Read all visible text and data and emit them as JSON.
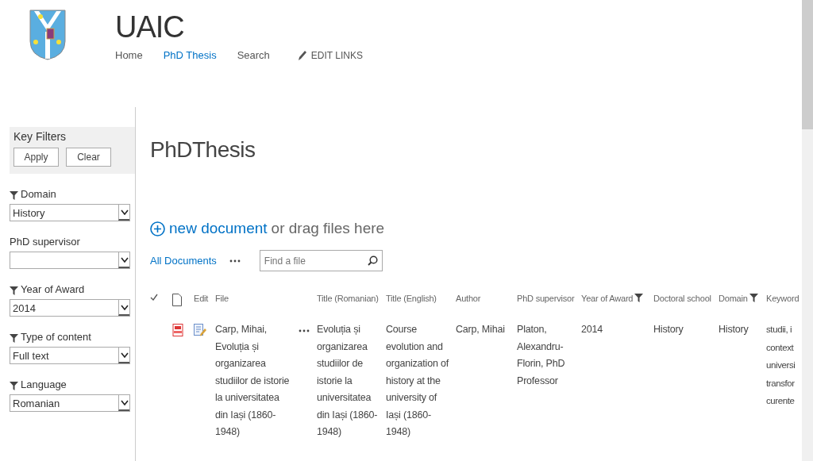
{
  "site": {
    "title": "UAIC",
    "nav": [
      {
        "label": "Home",
        "selected": false
      },
      {
        "label": "PhD Thesis",
        "selected": true
      },
      {
        "label": "Search",
        "selected": false
      }
    ],
    "edit_links": "EDIT LINKS"
  },
  "key_filters": {
    "title": "Key Filters",
    "buttons": [
      "Apply",
      "Clear"
    ],
    "filters": [
      {
        "label": "Domain",
        "filtered": true,
        "value": "History"
      },
      {
        "label": "PhD supervisor",
        "filtered": false
      },
      {
        "label": "Year of Award",
        "filtered": true,
        "value": "2014"
      },
      {
        "label": "Type of content",
        "filtered": true,
        "value": "Full text"
      },
      {
        "label": "Language",
        "filtered": true,
        "value": "Romanian"
      }
    ]
  },
  "page_title": "PhDThesis",
  "upload": {
    "link": "new document",
    "hint": "or drag files here"
  },
  "views": {
    "current": "All Documents"
  },
  "search": {
    "placeholder": "Find a file"
  },
  "table": {
    "columns": [
      {
        "label": "Edit",
        "filtered": false
      },
      {
        "label": "File",
        "filtered": false
      },
      {
        "label": "Title (Romanian)",
        "filtered": false
      },
      {
        "label": "Title (English)",
        "filtered": false
      },
      {
        "label": "Author",
        "filtered": false
      },
      {
        "label": "PhD supervisor",
        "filtered": false
      },
      {
        "label": "Year of Award",
        "filtered": true
      },
      {
        "label": "Doctoral school",
        "filtered": false
      },
      {
        "label": "Domain",
        "filtered": true
      },
      {
        "label": "Keyword",
        "filtered": false
      }
    ],
    "rows": [
      {
        "cells": [
          "",
          "Carp, Mihai, Evoluția și organizarea studiilor de istorie la universitatea din Iași (1860-1948)",
          "Evoluția și organizarea studiilor de istorie la universitatea din Iași (1860-1948)",
          "Course evolution and organization of history at the university of Iași (1860-1948)",
          "Carp, Mihai",
          "Platon, Alexandru-Florin, PhD Professor",
          "2014",
          "History",
          "History"
        ],
        "keywords": [
          "studii, i",
          "context",
          "universi",
          "transfor",
          "curente"
        ]
      }
    ]
  }
}
